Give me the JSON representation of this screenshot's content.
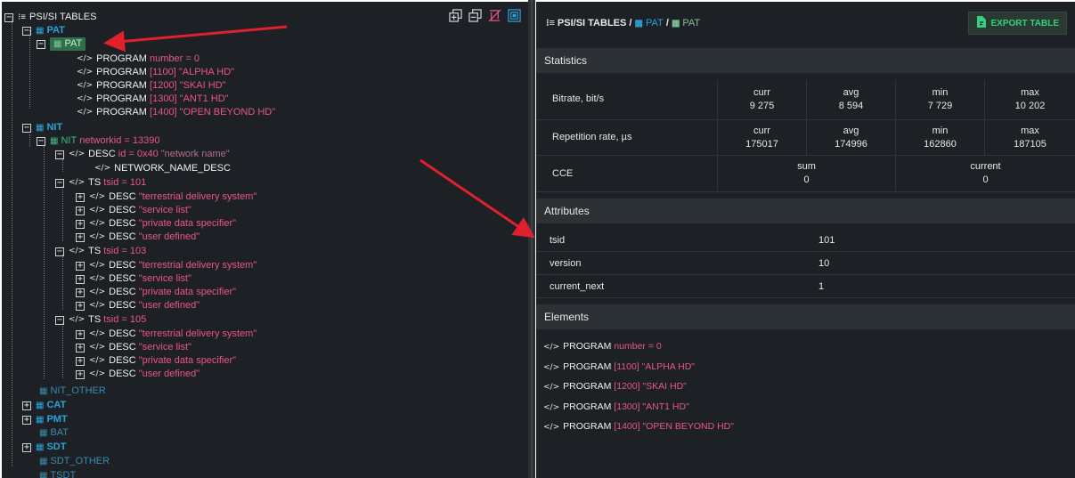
{
  "tree": {
    "root_label": "PSI/SI TABLES",
    "pat_group": "PAT",
    "pat_table": "PAT",
    "pat_programs": [
      {
        "label": "PROGRAM",
        "detail": "number = 0"
      },
      {
        "label": "PROGRAM",
        "detail": "[1100] \"ALPHA HD\""
      },
      {
        "label": "PROGRAM",
        "detail": "[1200] \"SKAI HD\""
      },
      {
        "label": "PROGRAM",
        "detail": "[1300] \"ANT1 HD\""
      },
      {
        "label": "PROGRAM",
        "detail": "[1400] \"OPEN BEYOND HD\""
      }
    ],
    "nit_group": "NIT",
    "nit_table": "NIT",
    "nit_table_detail": "networkid = 13390",
    "nit_desc": "DESC",
    "nit_desc_detail": "id = 0x40",
    "nit_desc_name": "\"network name\"",
    "network_name_desc": "NETWORK_NAME_DESC",
    "ts_groups": [
      {
        "label": "TS",
        "detail": "tsid = 101"
      },
      {
        "label": "TS",
        "detail": "tsid = 103"
      },
      {
        "label": "TS",
        "detail": "tsid = 105"
      }
    ],
    "ts_descs": [
      {
        "label": "DESC",
        "detail": "\"terrestrial delivery system\""
      },
      {
        "label": "DESC",
        "detail": "\"service list\""
      },
      {
        "label": "DESC",
        "detail": "\"private data specifier\""
      },
      {
        "label": "DESC",
        "detail": "\"user defined\""
      }
    ],
    "other_tables": [
      "NIT_OTHER",
      "CAT",
      "PMT",
      "BAT",
      "SDT",
      "SDT_OTHER",
      "TSDT"
    ]
  },
  "breadcrumb": {
    "root": "PSI/SI TABLES",
    "sep": "/",
    "group": "PAT",
    "table": "PAT"
  },
  "export_label": "EXPORT TABLE",
  "statistics": {
    "title": "Statistics",
    "bitrate": {
      "label": "Bitrate, bit/s",
      "curr_label": "curr",
      "curr": "9 275",
      "avg_label": "avg",
      "avg": "8 594",
      "min_label": "min",
      "min": "7 729",
      "max_label": "max",
      "max": "10 202"
    },
    "repetition": {
      "label": "Repetition rate, µs",
      "curr_label": "curr",
      "curr": "175017",
      "avg_label": "avg",
      "avg": "174996",
      "min_label": "min",
      "min": "162860",
      "max_label": "max",
      "max": "187105"
    },
    "cce": {
      "label": "CCE",
      "sum_label": "sum",
      "sum": "0",
      "current_label": "current",
      "current": "0"
    }
  },
  "attributes": {
    "title": "Attributes",
    "rows": [
      {
        "key": "tsid",
        "value": "101"
      },
      {
        "key": "version",
        "value": "10"
      },
      {
        "key": "current_next",
        "value": "1"
      }
    ]
  },
  "elements": {
    "title": "Elements",
    "items": [
      {
        "label": "PROGRAM",
        "detail": "number = 0"
      },
      {
        "label": "PROGRAM",
        "detail": "[1100] \"ALPHA HD\""
      },
      {
        "label": "PROGRAM",
        "detail": "[1200] \"SKAI HD\""
      },
      {
        "label": "PROGRAM",
        "detail": "[1300] \"ANT1 HD\""
      },
      {
        "label": "PROGRAM",
        "detail": "[1400] \"OPEN BEYOND HD\""
      }
    ]
  },
  "colors": {
    "accent_blue": "#2aa3d8",
    "accent_pink": "#e9568a",
    "export_green": "#35d07f",
    "arrow_red": "#e0202a",
    "panel_bg": "#1d2125"
  },
  "icons": [
    "tree-root-icon",
    "table-icon",
    "code-icon",
    "expand-icon",
    "collapse-icon",
    "copy-icon",
    "hide-icon",
    "fit-icon",
    "export-file-icon"
  ]
}
